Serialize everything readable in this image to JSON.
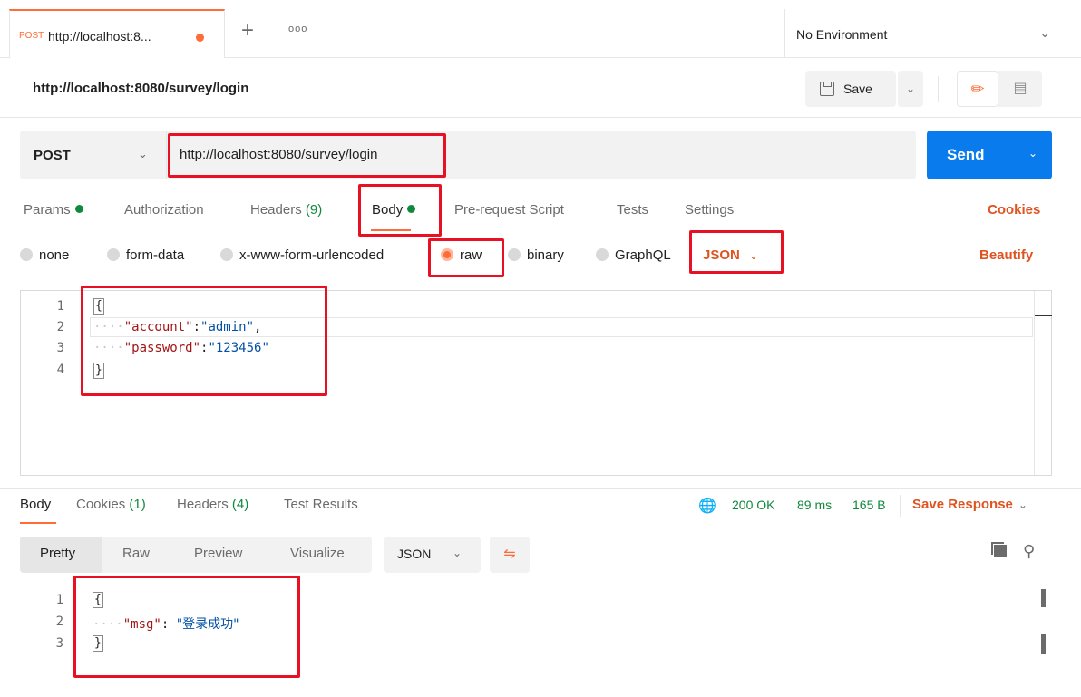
{
  "tab": {
    "method": "POST",
    "title": "http://localhost:8...",
    "more": "ooo"
  },
  "environment": {
    "label": "No Environment"
  },
  "header": {
    "title": "http://localhost:8080/survey/login",
    "save_label": "Save"
  },
  "request": {
    "method": "POST",
    "url": "http://localhost:8080/survey/login",
    "send_label": "Send"
  },
  "request_tabs": [
    {
      "label": "Params",
      "dot": true
    },
    {
      "label": "Authorization"
    },
    {
      "label": "Headers",
      "count": "(9)"
    },
    {
      "label": "Body",
      "dot": true,
      "active": true
    },
    {
      "label": "Pre-request Script"
    },
    {
      "label": "Tests"
    },
    {
      "label": "Settings"
    }
  ],
  "cookies_label": "Cookies",
  "body_types": [
    {
      "label": "none"
    },
    {
      "label": "form-data"
    },
    {
      "label": "x-www-form-urlencoded"
    },
    {
      "label": "raw",
      "selected": true
    },
    {
      "label": "binary"
    },
    {
      "label": "GraphQL"
    }
  ],
  "raw_format": "JSON",
  "beautify_label": "Beautify",
  "request_body": {
    "line_numbers": [
      "1",
      "2",
      "3",
      "4"
    ],
    "open_brace": "{",
    "close_brace": "}",
    "guide": "····",
    "entries": [
      {
        "key": "\"account\"",
        "colon": ":",
        "value": "\"admin\"",
        "comma": ","
      },
      {
        "key": "\"password\"",
        "colon": ":",
        "value": "\"123456\"",
        "comma": ""
      }
    ]
  },
  "response_tabs": [
    {
      "label": "Body",
      "active": true
    },
    {
      "label": "Cookies",
      "count": "(1)"
    },
    {
      "label": "Headers",
      "count": "(4)"
    },
    {
      "label": "Test Results"
    }
  ],
  "response_status": {
    "status": "200 OK",
    "time": "89 ms",
    "size": "165 B",
    "save_response": "Save Response"
  },
  "view_modes": [
    "Pretty",
    "Raw",
    "Preview",
    "Visualize"
  ],
  "response_format": "JSON",
  "response_body": {
    "line_numbers": [
      "1",
      "2",
      "3"
    ],
    "open_brace": "{",
    "close_brace": "}",
    "guide": "····",
    "key": "\"msg\"",
    "colon": ": ",
    "value": "\"登录成功\""
  },
  "icons": {
    "tab_dot_color": "#ff6c37",
    "accent": "#ff6c37",
    "send_color": "#097bed",
    "annotation_color": "#e81123",
    "success_color": "#0f8a3c"
  }
}
